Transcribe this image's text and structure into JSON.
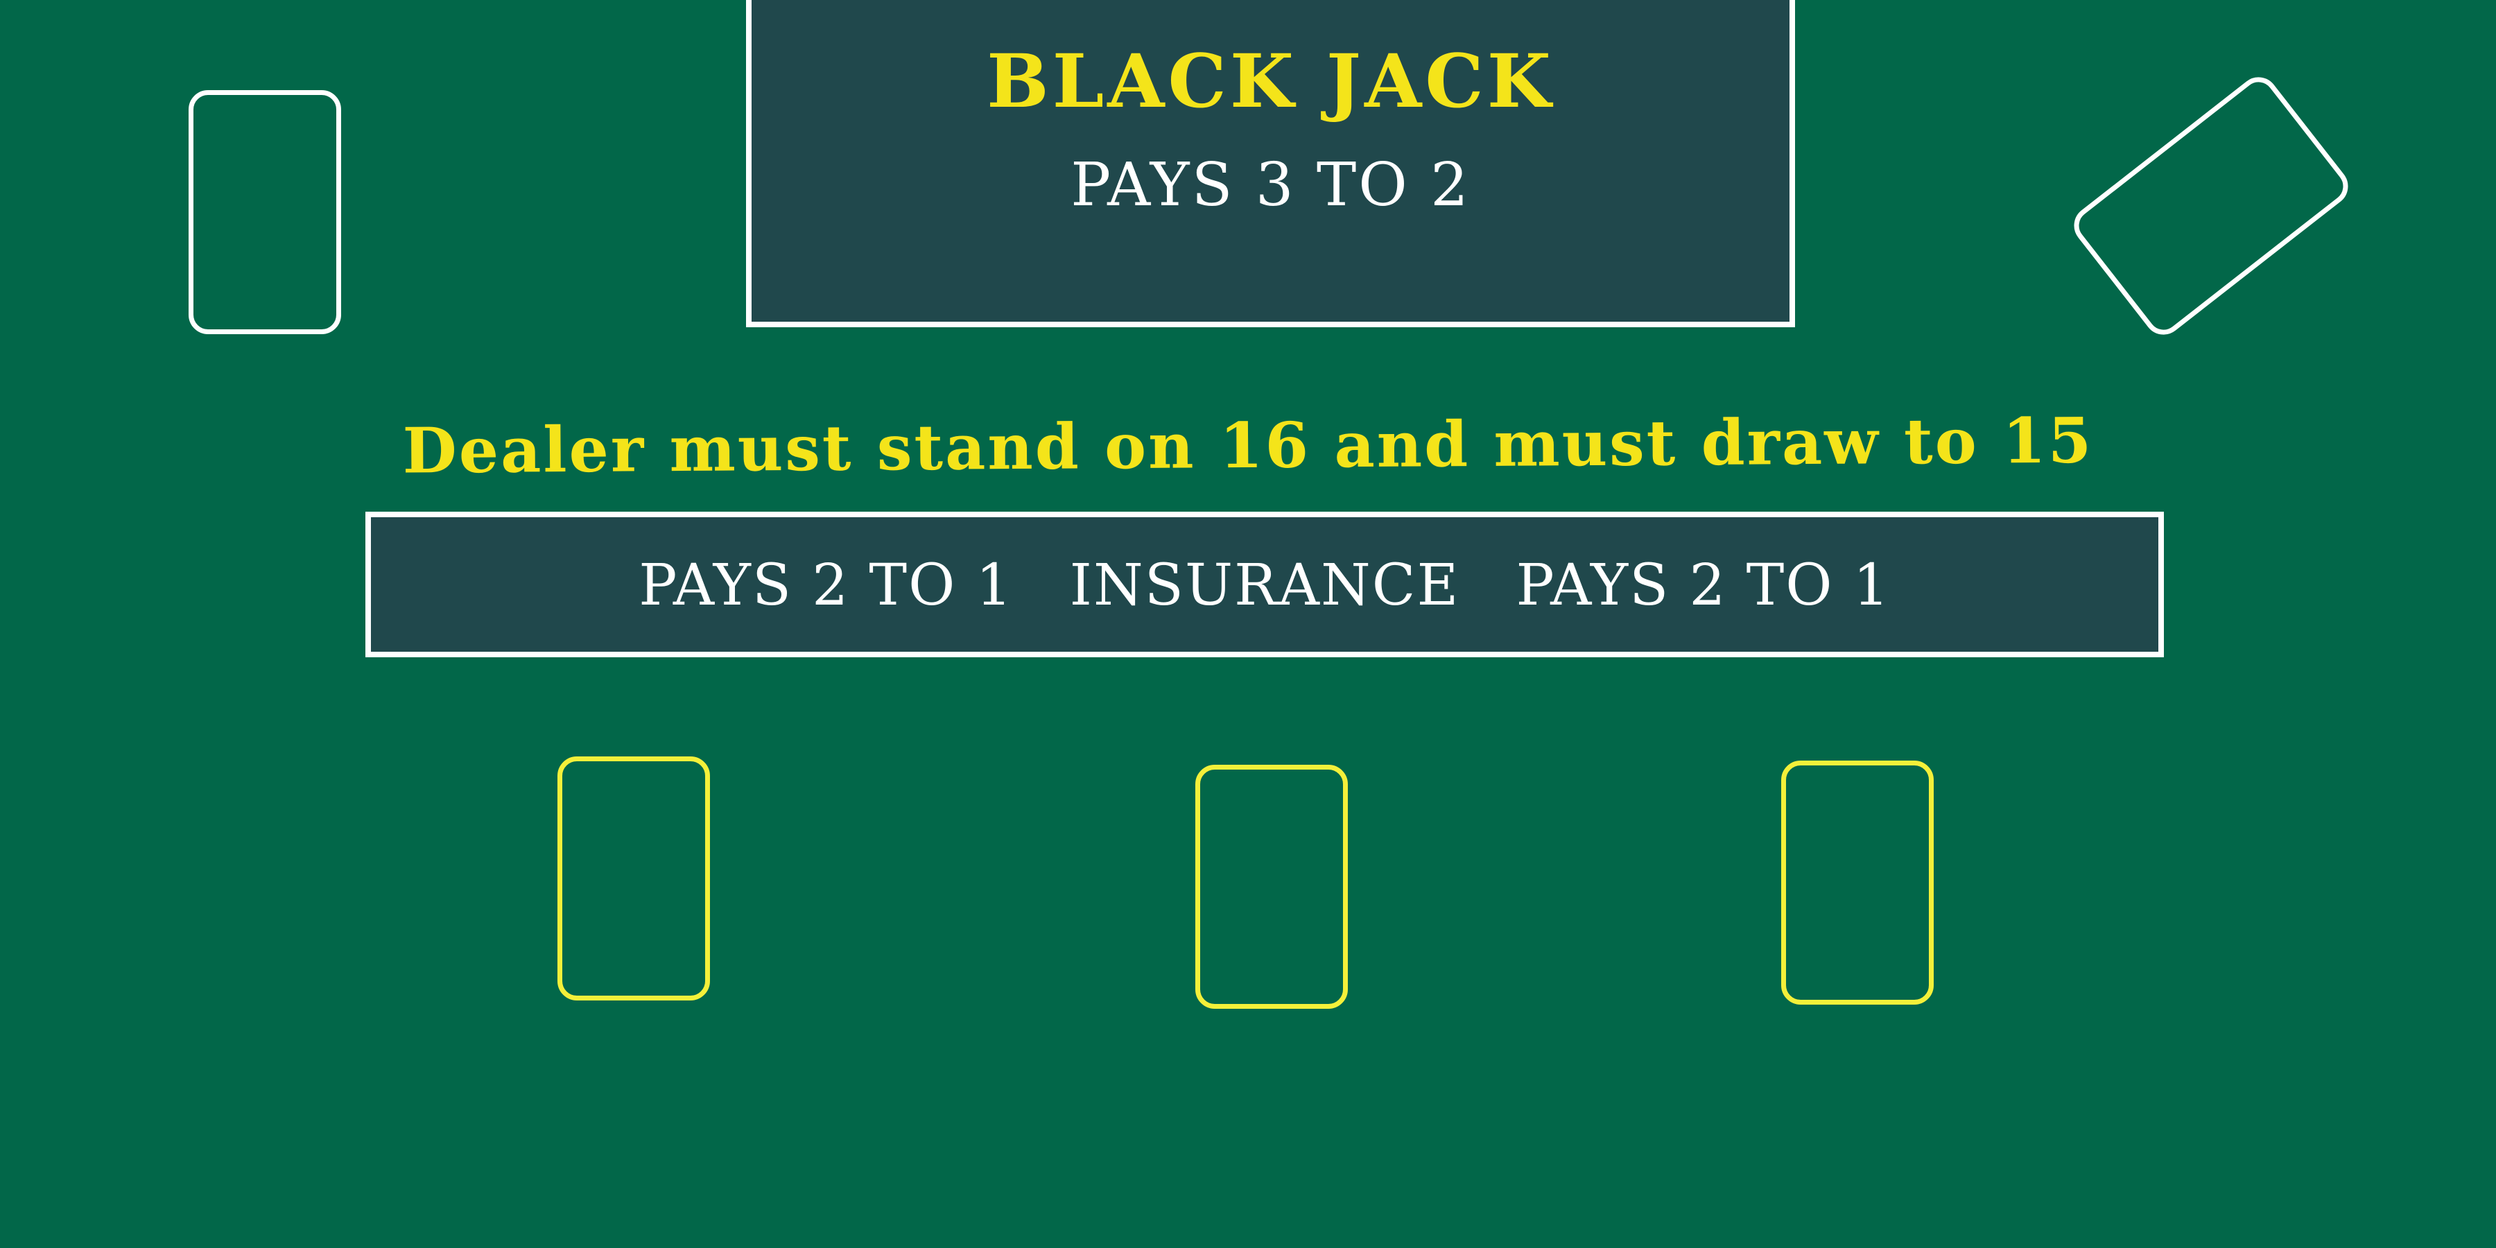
{
  "table": {
    "title": "BLACK JACK",
    "title_payout": "PAYS 3 TO 2",
    "dealer_rule": "Dealer must stand on 16 and must draw to 15",
    "insurance": {
      "left_payout": "PAYS 2 TO 1",
      "label": "INSURANCE",
      "right_payout": "PAYS 2 TO 1"
    }
  },
  "colors": {
    "felt": "#026749",
    "panel": "#20484C",
    "accent_yellow": "#F4E41A",
    "outline_white": "#FFFFFF",
    "spot_yellow": "#F4F03A"
  }
}
